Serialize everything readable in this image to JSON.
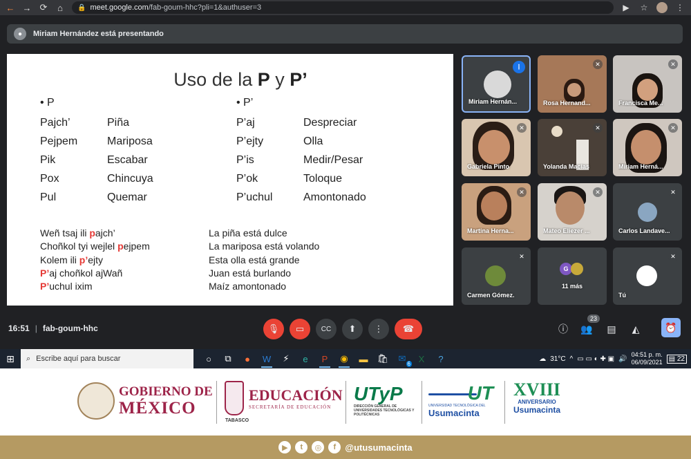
{
  "browser": {
    "url_host": "meet.google.com",
    "url_path": "/fab-goum-hhc?pli=1&authuser=3"
  },
  "presenting": {
    "text": "Miriam Hernández está presentando"
  },
  "slide": {
    "title_prefix": "Uso de la ",
    "title_p": "P",
    "title_y": " y ",
    "title_p2": "P’",
    "heading_left": "• P",
    "heading_right": "• P’",
    "left_words": [
      "Pajch’",
      "Pejpem",
      "Pik",
      "Pox",
      "Pul"
    ],
    "left_meanings": [
      "Piña",
      "Mariposa",
      "Escabar",
      "Chincuya",
      "Quemar"
    ],
    "right_words": [
      "P’aj",
      "P’ejty",
      "P’is",
      "P’ok",
      "P’uchul"
    ],
    "right_meanings": [
      "Despreciar",
      "Olla",
      "Medir/Pesar",
      "Toloque",
      "Amontonado"
    ],
    "sentences": [
      {
        "pre": "Weñ tsaj ili ",
        "hl": "p",
        "post": "ajch’"
      },
      {
        "pre": "Choñkol tyi wejlel ",
        "hl": "p",
        "post": "ejpem"
      },
      {
        "pre": "Kolem ili ",
        "hl": "p’",
        "post": "ejty"
      },
      {
        "pre": "",
        "hl": "P’",
        "post": "aj choñkol ajWañ"
      },
      {
        "pre": "",
        "hl": "P’",
        "post": "uchul ixim"
      }
    ],
    "translations": [
      "La piña está dulce",
      "La mariposa está volando",
      "Esta olla está grande",
      "Juan está burlando",
      "Maíz amontonado"
    ]
  },
  "participants": [
    "Miriam Hernán...",
    "Rosa Hernand...",
    "Francisca Me...",
    "Gabriela Pinto",
    "Yolanda Macias",
    "Miriam Herná...",
    "Martina Herna...",
    "Mateo Eliezer ...",
    "Carlos Landave...",
    "Carmen Gómez.",
    "11 más",
    "Tú"
  ],
  "more_initial": "G",
  "meetbar": {
    "time": "16:51",
    "code": "fab-goum-hhc",
    "participants_count": "23"
  },
  "taskbar": {
    "search_placeholder": "Escribe aquí para buscar",
    "outlook_badge": "6",
    "weather": "31°C",
    "time": "04:51 p. m.",
    "date": "06/09/2021",
    "notifications": "22"
  },
  "branding": {
    "gob_line1": "GOBIERNO DE",
    "gob_line2": "MÉXICO",
    "edu_title": "EDUCACIÓN",
    "edu_sub": "SECRETARÍA DE EDUCACIÓN",
    "edu_state": "TABASCO",
    "utp_logo": "UTyP",
    "utp_sub": "DIRECCIÓN GENERAL DE UNIVERSIDADES TECNOLÓGICAS Y POLITÉCNICAS",
    "ut_logo": "UT",
    "ut_sub": "UNIVERSIDAD TECNOLÓGICA DEL",
    "ut_name": "Usumacinta",
    "anniv_num": "XVIII",
    "anniv_word": "ANIVERSARIO",
    "anniv_name": "Usumacinta"
  },
  "social": {
    "handle": "@utusumacinta"
  },
  "colors": {
    "meet_bg": "#202124",
    "tile_bg": "#3c4043",
    "red": "#ea4335",
    "gold": "#b59a62",
    "gob_maroon": "#9d2449"
  }
}
